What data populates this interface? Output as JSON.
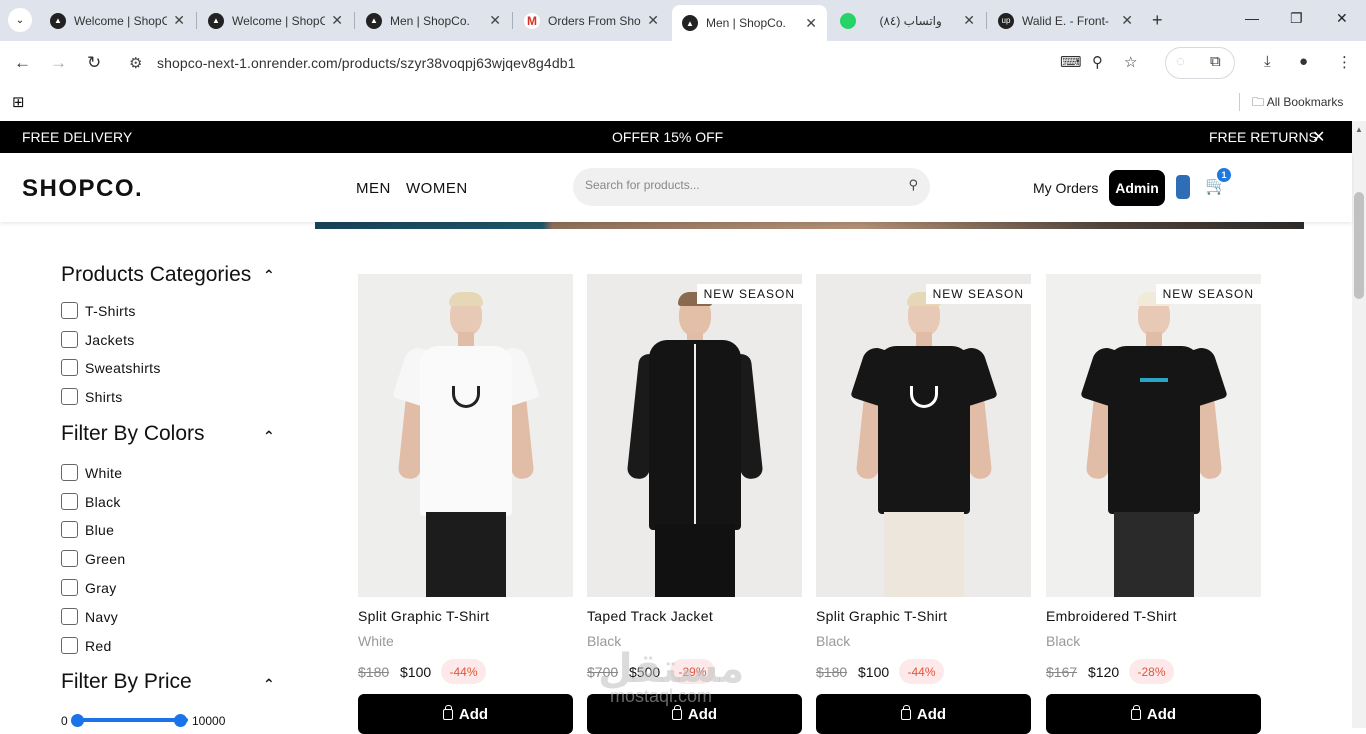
{
  "browser": {
    "tabs": [
      {
        "title": "Welcome | ShopCo",
        "icon": "vercel-icon"
      },
      {
        "title": "Welcome | ShopCo",
        "icon": "vercel-icon"
      },
      {
        "title": "Men | ShopCo.",
        "icon": "vercel-icon"
      },
      {
        "title": "Orders From ShopCo",
        "icon": "gmail-icon"
      },
      {
        "title": "Men | ShopCo.",
        "icon": "vercel-icon"
      },
      {
        "title": "(٨٤) واتساب",
        "icon": "whatsapp-icon"
      },
      {
        "title": "Walid E. - Front-",
        "icon": "upwork-icon"
      }
    ],
    "url": "shopco-next-1.onrender.com/products/szyr38voqpj63wjqev8g4db1",
    "bookmarks_label": "All Bookmarks"
  },
  "promo": {
    "left": "FREE DELIVERY",
    "center": "OFFER 15% OFF",
    "right": "FREE RETURNS"
  },
  "header": {
    "logo": "SHOPCO.",
    "nav": [
      "MEN",
      "WOMEN"
    ],
    "search_placeholder": "Search for products...",
    "my_orders": "My Orders",
    "admin": "Admin",
    "cart_count": "1"
  },
  "filters": {
    "categories_title": "Products Categories",
    "categories": [
      "T-Shirts",
      "Jackets",
      "Sweatshirts",
      "Shirts"
    ],
    "colors_title": "Filter By Colors",
    "colors": [
      "White",
      "Black",
      "Blue",
      "Green",
      "Gray",
      "Navy",
      "Red"
    ],
    "price_title": "Filter By Price",
    "price_min": "0",
    "price_max": "10000"
  },
  "products": [
    {
      "name": "Split Graphic T-Shirt",
      "color": "White",
      "old_price": "$180",
      "price": "$100",
      "discount": "-44%",
      "badge": "",
      "add": "Add"
    },
    {
      "name": "Taped Track Jacket",
      "color": "Black",
      "old_price": "$700",
      "price": "$500",
      "discount": "-29%",
      "badge": "NEW SEASON",
      "add": "Add"
    },
    {
      "name": "Split Graphic T-Shirt",
      "color": "Black",
      "old_price": "$180",
      "price": "$100",
      "discount": "-44%",
      "badge": "NEW SEASON",
      "add": "Add"
    },
    {
      "name": "Embroidered T-Shirt",
      "color": "Black",
      "old_price": "$167",
      "price": "$120",
      "discount": "-28%",
      "badge": "NEW SEASON",
      "add": "Add"
    }
  ],
  "watermark": {
    "arabic": "مستقل",
    "latin": "mostaql.com"
  }
}
